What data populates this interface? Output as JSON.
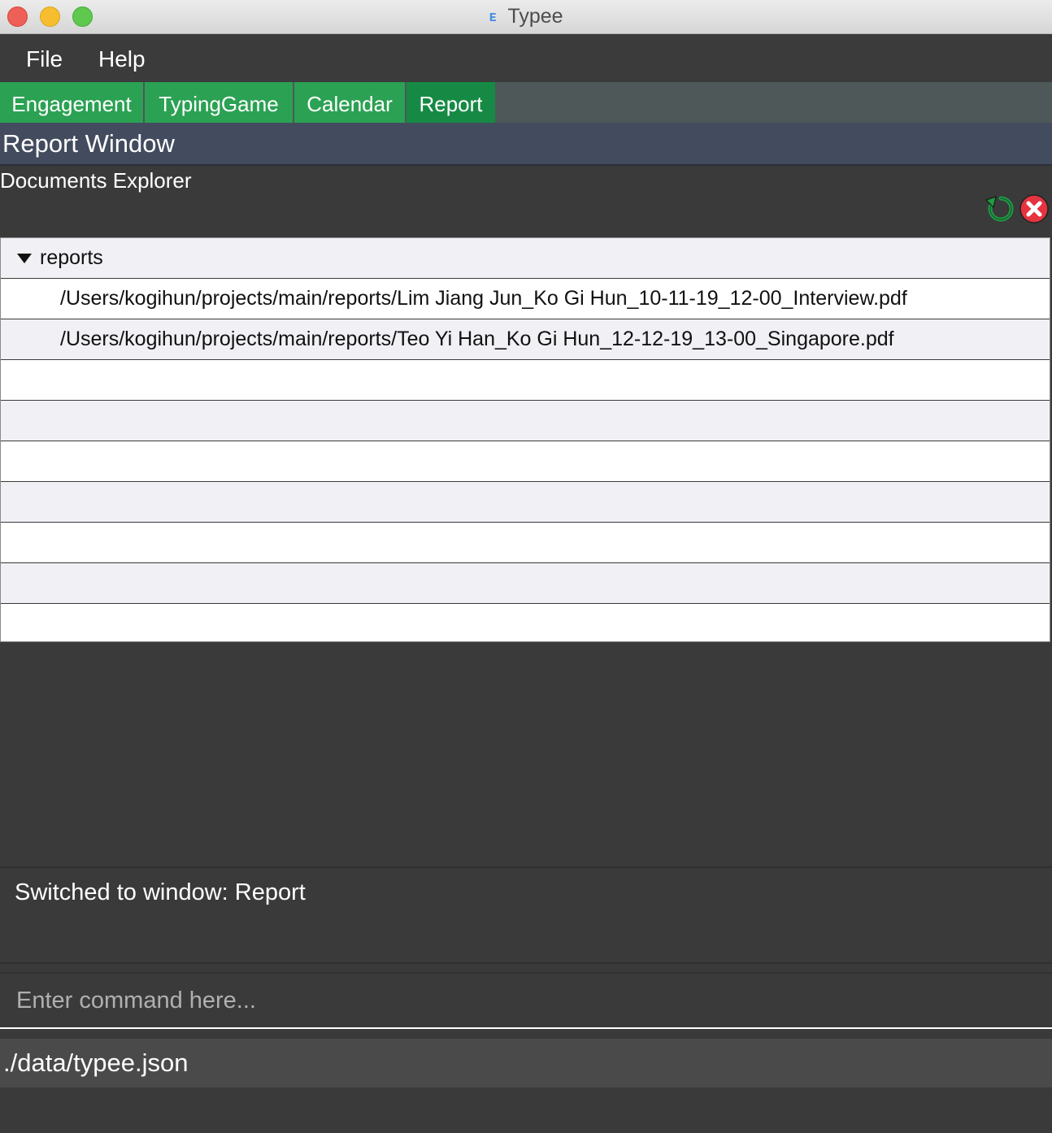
{
  "window": {
    "title": "Typee",
    "app_glyph": "ᴇ"
  },
  "menu": {
    "file": "File",
    "help": "Help"
  },
  "tabs": [
    {
      "label": "Engagement"
    },
    {
      "label": "TypingGame"
    },
    {
      "label": "Calendar"
    },
    {
      "label": "Report",
      "active": true
    }
  ],
  "section": {
    "title": "Report Window"
  },
  "explorer": {
    "title": "Documents Explorer",
    "refresh_icon": "refresh-icon",
    "close_icon": "close-icon",
    "root": "reports",
    "files": [
      "/Users/kogihun/projects/main/reports/Lim Jiang Jun_Ko Gi Hun_10-11-19_12-00_Interview.pdf",
      "/Users/kogihun/projects/main/reports/Teo Yi Han_Ko Gi Hun_12-12-19_13-00_Singapore.pdf"
    ]
  },
  "result": {
    "message": "Switched to window: Report"
  },
  "command": {
    "placeholder": "Enter command here...",
    "value": ""
  },
  "status": {
    "path": "./data/typee.json"
  },
  "colors": {
    "tab": "#2ba153",
    "tab_active": "#168a44",
    "header": "#434c5e",
    "background": "#3a3a3a"
  }
}
